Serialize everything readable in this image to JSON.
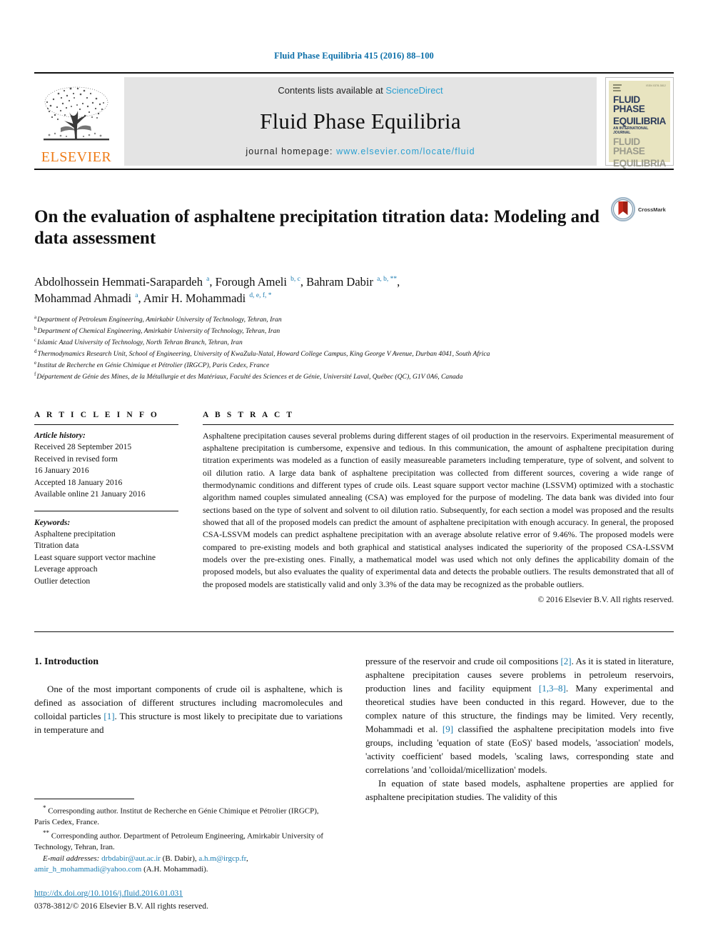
{
  "running_head": "Fluid Phase Equilibria 415 (2016) 88–100",
  "masthead": {
    "publisher": "ELSEVIER",
    "contents_prefix": "Contents lists available at ",
    "contents_link": "ScienceDirect",
    "journal_name": "Fluid Phase Equilibria",
    "homepage_prefix": "journal homepage: ",
    "homepage_url": "www.elsevier.com/locate/fluid",
    "cover": {
      "line1": "FLUID PHASE",
      "line2": "EQUILIBRIA",
      "subtitle": "AN INTERNATIONAL JOURNAL",
      "line3": "FLUID PHASE",
      "line4": "EQUILIBRIA",
      "corner_text": "ISSN 0378-3812"
    }
  },
  "article": {
    "title": "On the evaluation of asphaltene precipitation titration data: Modeling and data assessment",
    "crossmark_label": "CrossMark",
    "authors_line1_a": "Abdolhossein Hemmati-Sarapardeh ",
    "authors_sup1": "a",
    "authors_line1_b": ", Forough Ameli ",
    "authors_sup2": "b, c",
    "authors_line1_c": ", Bahram Dabir ",
    "authors_sup3": "a, b, **",
    "authors_line1_d": ",",
    "authors_line2_a": "Mohammad Ahmadi ",
    "authors_sup4": "a",
    "authors_line2_b": ", Amir H. Mohammadi ",
    "authors_sup5": "d, e, f, *",
    "affiliations": [
      {
        "mark": "a",
        "text": "Department of Petroleum Engineering, Amirkabir University of Technology, Tehran, Iran"
      },
      {
        "mark": "b",
        "text": "Department of Chemical Engineering, Amirkabir University of Technology, Tehran, Iran"
      },
      {
        "mark": "c",
        "text": "Islamic Azad University of Technology, North Tehran Branch, Tehran, Iran"
      },
      {
        "mark": "d",
        "text": "Thermodynamics Research Unit, School of Engineering, University of KwaZulu-Natal, Howard College Campus, King George V Avenue, Durban 4041, South Africa"
      },
      {
        "mark": "e",
        "text": "Institut de Recherche en Génie Chimique et Pétrolier (IRGCP), Paris Cedex, France"
      },
      {
        "mark": "f",
        "text": "Département de Génie des Mines, de la Métallurgie et des Matériaux, Faculté des Sciences et de Génie, Université Laval, Québec (QC), G1V 0A6, Canada"
      }
    ]
  },
  "article_info": {
    "heading": "A R T I C L E  I N F O",
    "history_label": "Article history:",
    "history": [
      "Received 28 September 2015",
      "Received in revised form",
      "16 January 2016",
      "Accepted 18 January 2016",
      "Available online 21 January 2016"
    ],
    "keywords_label": "Keywords:",
    "keywords": [
      "Asphaltene precipitation",
      "Titration data",
      "Least square support vector machine",
      "Leverage approach",
      "Outlier detection"
    ]
  },
  "abstract": {
    "heading": "A B S T R A C T",
    "text": "Asphaltene precipitation causes several problems during different stages of oil production in the reservoirs. Experimental measurement of asphaltene precipitation is cumbersome, expensive and tedious. In this communication, the amount of asphaltene precipitation during titration experiments was modeled as a function of easily measureable parameters including temperature, type of solvent, and solvent to oil dilution ratio. A large data bank of asphaltene precipitation was collected from different sources, covering a wide range of thermodynamic conditions and different types of crude oils. Least square support vector machine (LSSVM) optimized with a stochastic algorithm named couples simulated annealing (CSA) was employed for the purpose of modeling. The data bank was divided into four sections based on the type of solvent and solvent to oil dilution ratio. Subsequently, for each section a model was proposed and the results showed that all of the proposed models can predict the amount of asphaltene precipitation with enough accuracy. In general, the proposed CSA-LSSVM models can predict asphaltene precipitation with an average absolute relative error of 9.46%. The proposed models were compared to pre-existing models and both graphical and statistical analyses indicated the superiority of the proposed CSA-LSSVM models over the pre-existing ones. Finally, a mathematical model was used which not only defines the applicability domain of the proposed models, but also evaluates the quality of experimental data and detects the probable outliers. The results demonstrated that all of the proposed models are statistically valid and only 3.3% of the data may be recognized as the probable outliers.",
    "copyright": "© 2016 Elsevier B.V. All rights reserved."
  },
  "body": {
    "section_number_title": "1. Introduction",
    "left_paragraph_a": "One of the most important components of crude oil is asphaltene, which is defined as association of different structures including macromolecules and colloidal particles ",
    "left_ref_1": "[1]",
    "left_paragraph_b": ". This structure is most likely to precipitate due to variations in temperature and",
    "right_paragraph_a": "pressure of the reservoir and crude oil compositions ",
    "right_ref_2": "[2]",
    "right_paragraph_b": ". As it is stated in literature, asphaltene precipitation causes severe problems in petroleum reservoirs, production lines and facility equipment ",
    "right_ref_38": "[1,3–8]",
    "right_paragraph_c": ". Many experimental and theoretical studies have been conducted in this regard. However, due to the complex nature of this structure, the findings may be limited. Very recently, Mohammadi et al. ",
    "right_ref_9": "[9]",
    "right_paragraph_d": " classified the asphaltene precipitation models into five groups, including 'equation of state (EoS)' based models, 'association' models, 'activity coefficient' based models, 'scaling laws, corresponding state and correlations 'and 'colloidal/micellization' models.",
    "right_paragraph_e": "In equation of state based models, asphaltene properties are applied for asphaltene precipitation studies. The validity of this"
  },
  "footnotes": {
    "corr1_mark": "*",
    "corr1": " Corresponding author. Institut de Recherche en Génie Chimique et Pétrolier (IRGCP), Paris Cedex, France.",
    "corr2_mark": "**",
    "corr2": " Corresponding author. Department of Petroleum Engineering, Amirkabir University of Technology, Tehran, Iran.",
    "email_label": "E-mail addresses: ",
    "email1": "drbdabir@aut.ac.ir",
    "email1_owner": " (B. Dabir), ",
    "email2": "a.h.m@irgcp.fr",
    "email2_sep": ", ",
    "email3": "amir_h_mohammadi@yahoo.com",
    "email3_owner": " (A.H. Mohammadi).",
    "doi": "http://dx.doi.org/10.1016/j.fluid.2016.01.031",
    "issn": "0378-3812/© 2016 Elsevier B.V. All rights reserved."
  },
  "colors": {
    "link_blue": "#1a7bb0",
    "sciencedirect_blue": "#2a9fd0",
    "elsevier_orange": "#ef7c18",
    "masthead_grey": "#e4e4e4",
    "cover_cream": "#e8e4c0",
    "cover_navy": "#2d3c5c"
  }
}
